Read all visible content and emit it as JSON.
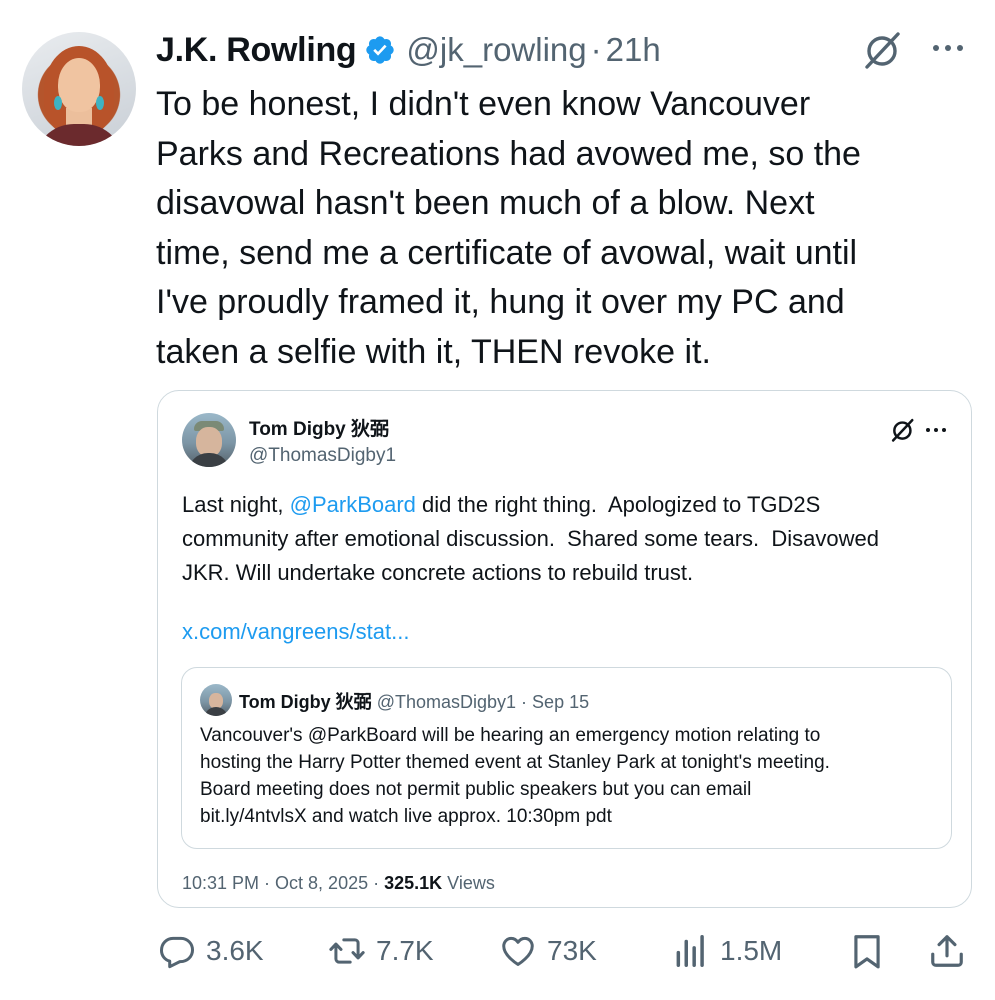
{
  "author": {
    "name": "J.K. Rowling",
    "handle": "@jk_rowling",
    "separator": "·",
    "time": "21h"
  },
  "tweet_text": "To be honest, I didn't even know Vancouver\nParks and Recreations had avowed me, so the\ndisavowal hasn't been much of a blow. Next\ntime, send me a certificate of avowal, wait until\nI've proudly framed it, hung it over my PC and\ntaken a selfie with it, THEN revoke it.",
  "quote": {
    "name": "Tom Digby 狄弼",
    "handle": "@ThomasDigby1",
    "text_before": "Last night, ",
    "mention": "@ParkBoard",
    "text_after": " did the right thing.  Apologized to TGD2S\ncommunity after emotional discussion.  Shared some tears.  Disavowed\nJKR. Will undertake concrete actions to rebuild trust.",
    "link": "x.com/vangreens/stat...",
    "nested": {
      "name": "Tom Digby 狄弼",
      "handle": "@ThomasDigby1",
      "separator": "·",
      "date": "Sep 15",
      "text": "Vancouver's @ParkBoard will be hearing an emergency motion relating to\nhosting the Harry Potter themed event at Stanley Park at tonight's meeting.\nBoard meeting does not permit public speakers but you can email\nbit.ly/4ntvlsX and watch live approx. 10:30pm pdt"
    },
    "timestamp": "10:31 PM · Oct 8, 2025 · ",
    "views_count": "325.1K",
    "views_label": " Views"
  },
  "actions": {
    "replies": "3.6K",
    "reposts": "7.7K",
    "likes": "73K",
    "views": "1.5M"
  },
  "colors": {
    "text": "#0f1419",
    "secondary": "#536471",
    "link": "#1d9bf0",
    "border": "#cfd9de",
    "verified": "#1d9bf0"
  },
  "icons": [
    "verified-badge-icon",
    "grok-icon",
    "more-icon",
    "reply-icon",
    "repost-icon",
    "like-icon",
    "views-icon",
    "bookmark-icon",
    "share-icon"
  ]
}
